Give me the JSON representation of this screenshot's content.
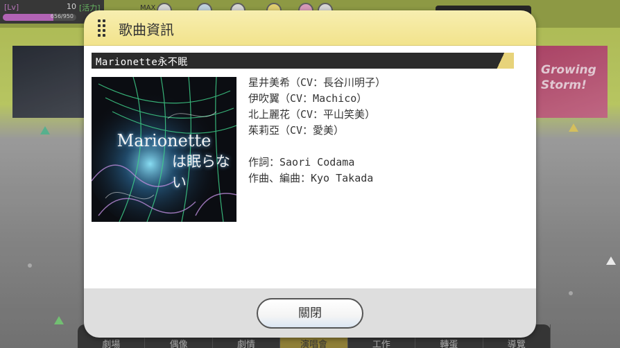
{
  "hud": {
    "level_badge": "[Lv]",
    "level": "10",
    "stamina_label": "[活力]",
    "exp_text": "656/950",
    "exp_fraction": 0.69,
    "max_label": "MAX"
  },
  "dialog": {
    "title": "歌曲資訊",
    "song_name": "Marionette永不眠",
    "jacket_title": "Marionette",
    "jacket_subtitle": "は眠らない",
    "singers": [
      "星井美希（CV：長谷川明子）",
      "伊吹翼（CV：Machico）",
      "北上麗花（CV：平山笑美）",
      "茱莉亞（CV：愛美）"
    ],
    "lyricist": "作詞：Saori Codama",
    "composer": "作曲、編曲：Kyo Takada",
    "close_label": "關閉"
  },
  "nav": [
    "劇場",
    "偶像",
    "劇情",
    "演唱會",
    "工作",
    "轉蛋",
    "導覽"
  ],
  "colors": {
    "header_yellow": "#f2e38c",
    "song_bar": "#2b2b2b",
    "accent_gold": "#e7d37a",
    "footer_gray": "#dedede"
  }
}
